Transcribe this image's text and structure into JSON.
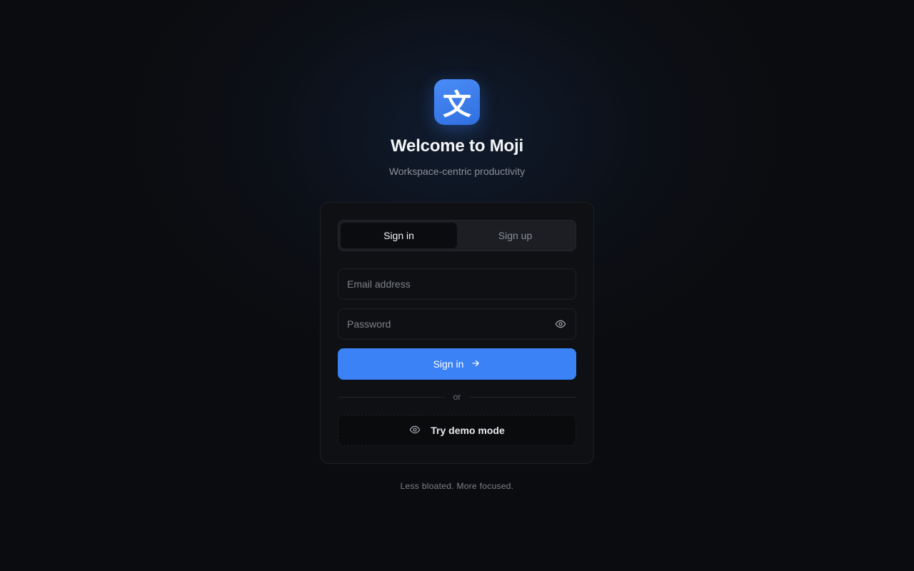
{
  "brand": {
    "logo_glyph": "文",
    "logo_color": "#3b82f6",
    "title": "Welcome to Moji",
    "subtitle": "Workspace-centric productivity"
  },
  "tabs": [
    {
      "label": "Sign in",
      "active": true
    },
    {
      "label": "Sign up",
      "active": false
    }
  ],
  "form": {
    "email": {
      "placeholder": "Email address",
      "value": ""
    },
    "password": {
      "placeholder": "Password",
      "value": "",
      "toggle_icon": "eye-icon"
    },
    "submit_label": "Sign in",
    "submit_icon": "arrow-right-icon",
    "divider_text": "or",
    "demo_label": "Try demo mode",
    "demo_icon": "eye-icon"
  },
  "footer": {
    "tagline": "Less bloated. More focused."
  },
  "colors": {
    "background": "#0b0c0f",
    "accent": "#3b82f6",
    "card": "#0f1013"
  }
}
